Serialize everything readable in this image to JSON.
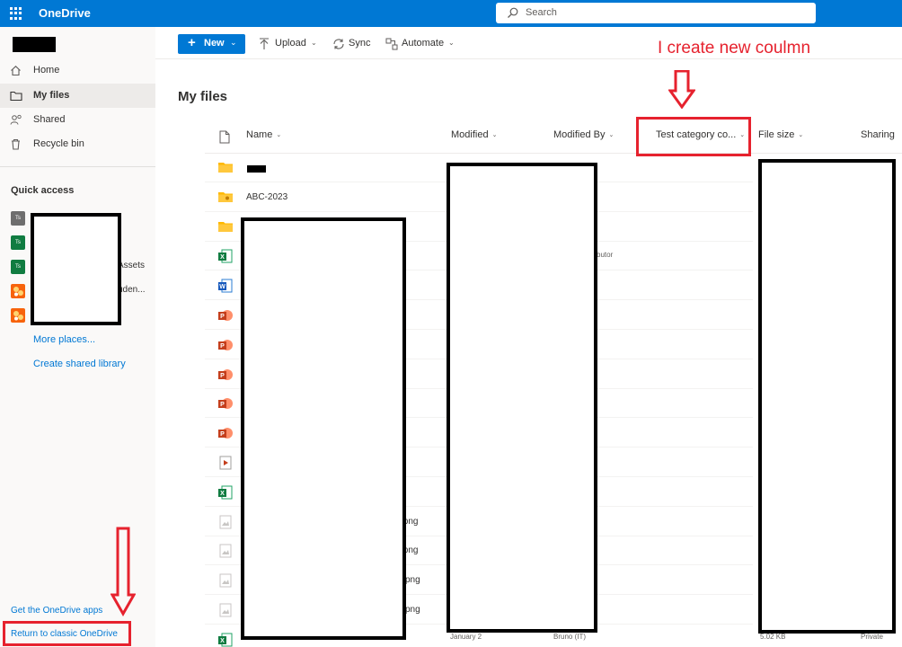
{
  "app": {
    "title": "OneDrive",
    "search_placeholder": "Search"
  },
  "nav": {
    "items": [
      {
        "label": "Home",
        "icon": "home-icon"
      },
      {
        "label": "My files",
        "icon": "folder-icon",
        "selected": true
      },
      {
        "label": "Shared",
        "icon": "shared-icon"
      },
      {
        "label": "Recycle bin",
        "icon": "recycle-bin-icon"
      }
    ],
    "quick_access_heading": "Quick access",
    "quick_access": [
      {
        "badge": "Ts",
        "label": "",
        "color": "#6e6e6e"
      },
      {
        "badge": "Ts",
        "label": "",
        "color": "#107c41"
      },
      {
        "badge": "Ts",
        "label": "Assets",
        "color": "#107c41"
      },
      {
        "badge": "",
        "label": "uden...",
        "color": "#f7630c"
      },
      {
        "badge": "",
        "label": "",
        "color": "#f7630c"
      }
    ],
    "more_places": "More places...",
    "create_shared_library": "Create shared library",
    "get_apps": "Get the OneDrive apps",
    "return_classic": "Return to classic OneDrive"
  },
  "toolbar": {
    "new": "New",
    "upload": "Upload",
    "sync": "Sync",
    "automate": "Automate"
  },
  "main": {
    "title": "My files",
    "columns": {
      "name": "Name",
      "modified": "Modified",
      "modified_by": "Modified By",
      "test_category": "Test category co...",
      "file_size": "File size",
      "sharing": "Sharing"
    },
    "rows": [
      {
        "type": "folder",
        "name": ""
      },
      {
        "type": "folder-shared",
        "name": "ABC-2023"
      },
      {
        "type": "folder",
        "name": ""
      },
      {
        "type": "excel",
        "name": ""
      },
      {
        "type": "word",
        "name": ""
      },
      {
        "type": "powerpoint",
        "name": ""
      },
      {
        "type": "powerpoint",
        "name": ""
      },
      {
        "type": "powerpoint",
        "name": ""
      },
      {
        "type": "powerpoint",
        "name": ""
      },
      {
        "type": "powerpoint",
        "name": ""
      },
      {
        "type": "video",
        "name": ""
      },
      {
        "type": "excel",
        "name": ""
      },
      {
        "type": "image",
        "name": ".png"
      },
      {
        "type": "image",
        "name": ".png"
      },
      {
        "type": "image",
        "name": "l.png"
      },
      {
        "type": "image",
        "name": "l.png"
      },
      {
        "type": "excel",
        "name": ""
      }
    ],
    "partial_texts": {
      "contributor": "butor",
      "last_modified": "January 2",
      "last_by": "Bruno (IT)",
      "last_size": "5.02 KB",
      "last_sharing": "Private"
    }
  },
  "annotation": {
    "text": "I create new coulmn",
    "color": "#e6222e"
  }
}
